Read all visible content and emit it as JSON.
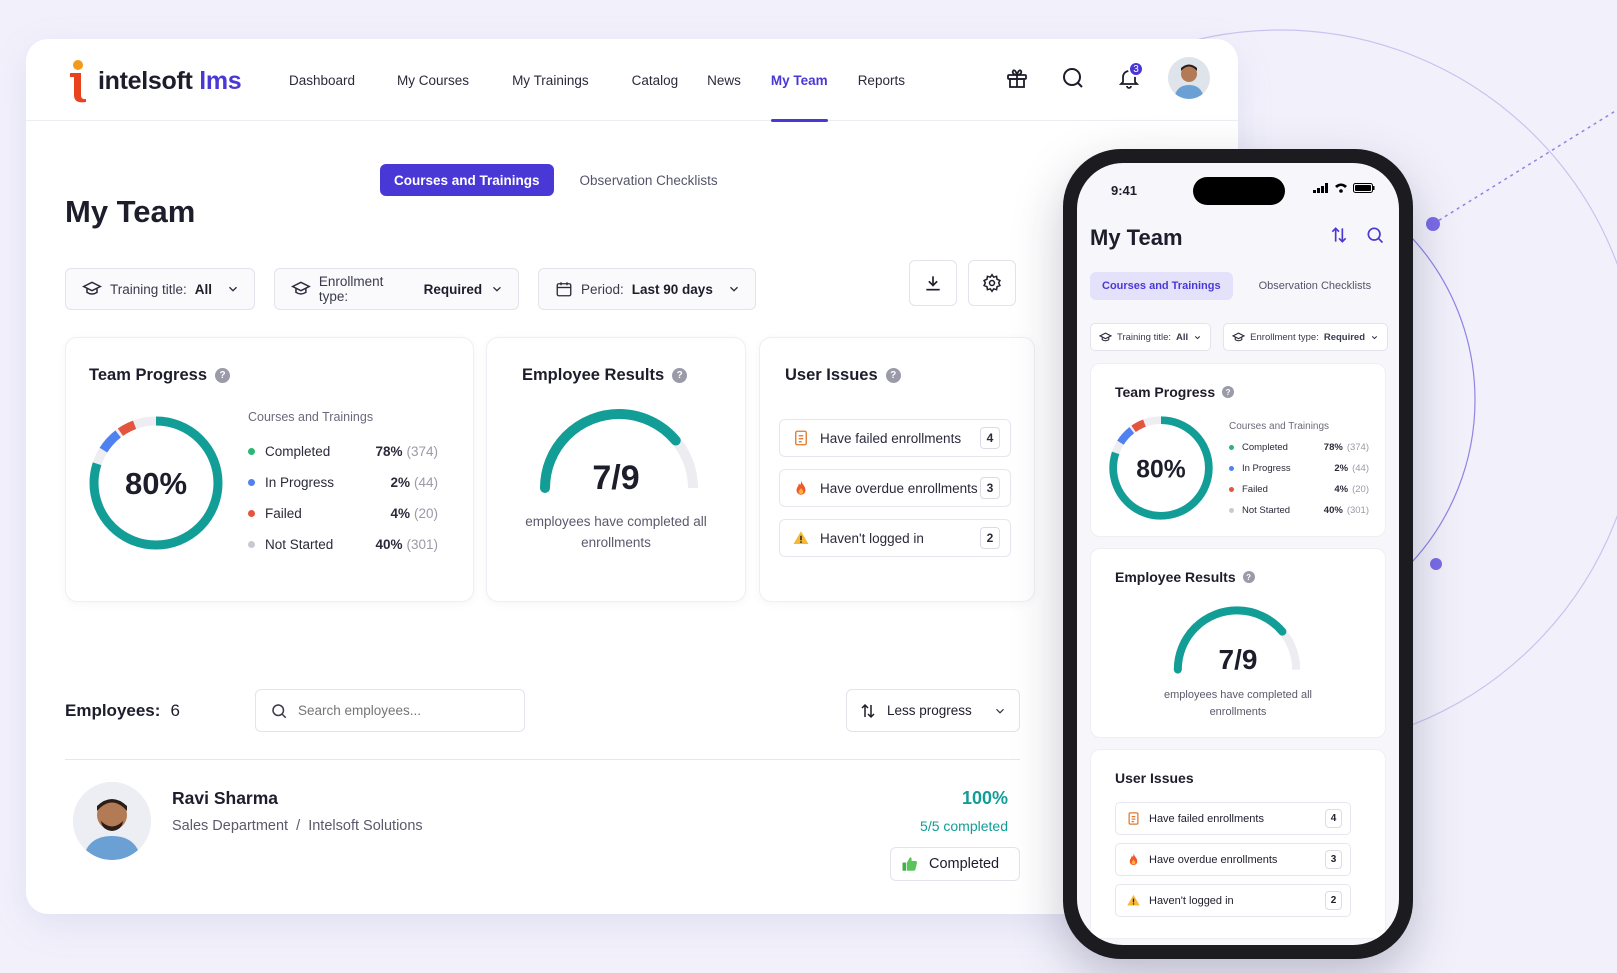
{
  "brand": {
    "name": "intelsoft",
    "suffix": "lms"
  },
  "nav": {
    "links": [
      "Dashboard",
      "My Courses",
      "My Trainings",
      "Catalog",
      "News",
      "My Team",
      "Reports"
    ],
    "active": "My Team",
    "notification_count": "3"
  },
  "tabs": {
    "active": "Courses and Trainings",
    "other": "Observation Checklists"
  },
  "page": {
    "title": "My Team"
  },
  "filters": {
    "training": {
      "label": "Training title:",
      "value": "All"
    },
    "enrollment": {
      "label": "Enrollment type:",
      "value": "Required"
    },
    "period": {
      "label": "Period:",
      "value": "Last 90 days"
    }
  },
  "team_progress": {
    "title": "Team Progress",
    "center": "80%",
    "percent": 80,
    "legend_title": "Courses and Trainings",
    "rows": [
      {
        "label": "Completed",
        "pct": "78%",
        "count": "(374)",
        "color": "#2bb673"
      },
      {
        "label": "In Progress",
        "pct": "2%",
        "count": "(44)",
        "color": "#4f82f0"
      },
      {
        "label": "Failed",
        "pct": "4%",
        "count": "(20)",
        "color": "#e4553f"
      },
      {
        "label": "Not Started",
        "pct": "40%",
        "count": "(301)",
        "color": "#c9c9d2"
      }
    ]
  },
  "employee_results": {
    "title": "Employee Results",
    "value": "7/9",
    "completed": 7,
    "total": 9,
    "caption_line1": "employees have completed all",
    "caption_line2": "enrollments"
  },
  "user_issues": {
    "title": "User Issues",
    "items": [
      {
        "label": "Have failed enrollments",
        "count": "4",
        "icon": "clipboard-icon"
      },
      {
        "label": "Have overdue enrollments",
        "count": "3",
        "icon": "fire-icon"
      },
      {
        "label": "Haven't logged in",
        "count": "2",
        "icon": "warning-icon"
      }
    ]
  },
  "employees": {
    "label": "Employees:",
    "count": "6",
    "search_placeholder": "Search employees...",
    "sort_label": "Less progress",
    "list": [
      {
        "name": "Ravi Sharma",
        "department": "Sales Department",
        "company": "Intelsoft Solutions",
        "progress": "100%",
        "completed_text": "5/5 completed",
        "status": "Completed"
      }
    ]
  },
  "phone": {
    "time": "9:41"
  },
  "colors": {
    "accent": "#4a38d6",
    "teal": "#129e96"
  }
}
